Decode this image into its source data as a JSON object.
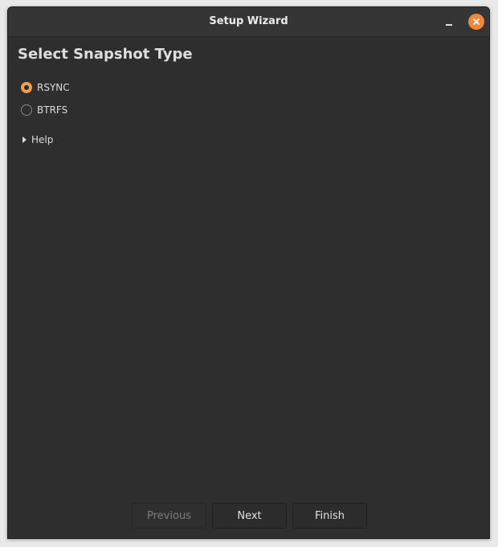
{
  "window": {
    "title": "Setup Wizard",
    "minimize_icon": "minimize-icon",
    "close_icon": "close-icon",
    "close_color": "#f0883a"
  },
  "main": {
    "heading": "Select Snapshot Type",
    "options": [
      {
        "label": "RSYNC",
        "checked": true
      },
      {
        "label": "BTRFS",
        "checked": false
      }
    ],
    "help": {
      "label": "Help",
      "expanded": false
    }
  },
  "footer": {
    "previous_label": "Previous",
    "previous_enabled": false,
    "next_label": "Next",
    "finish_label": "Finish"
  },
  "colors": {
    "accent": "#f0a04b",
    "window_bg": "#2e2e2e",
    "titlebar_bg": "#353535"
  }
}
